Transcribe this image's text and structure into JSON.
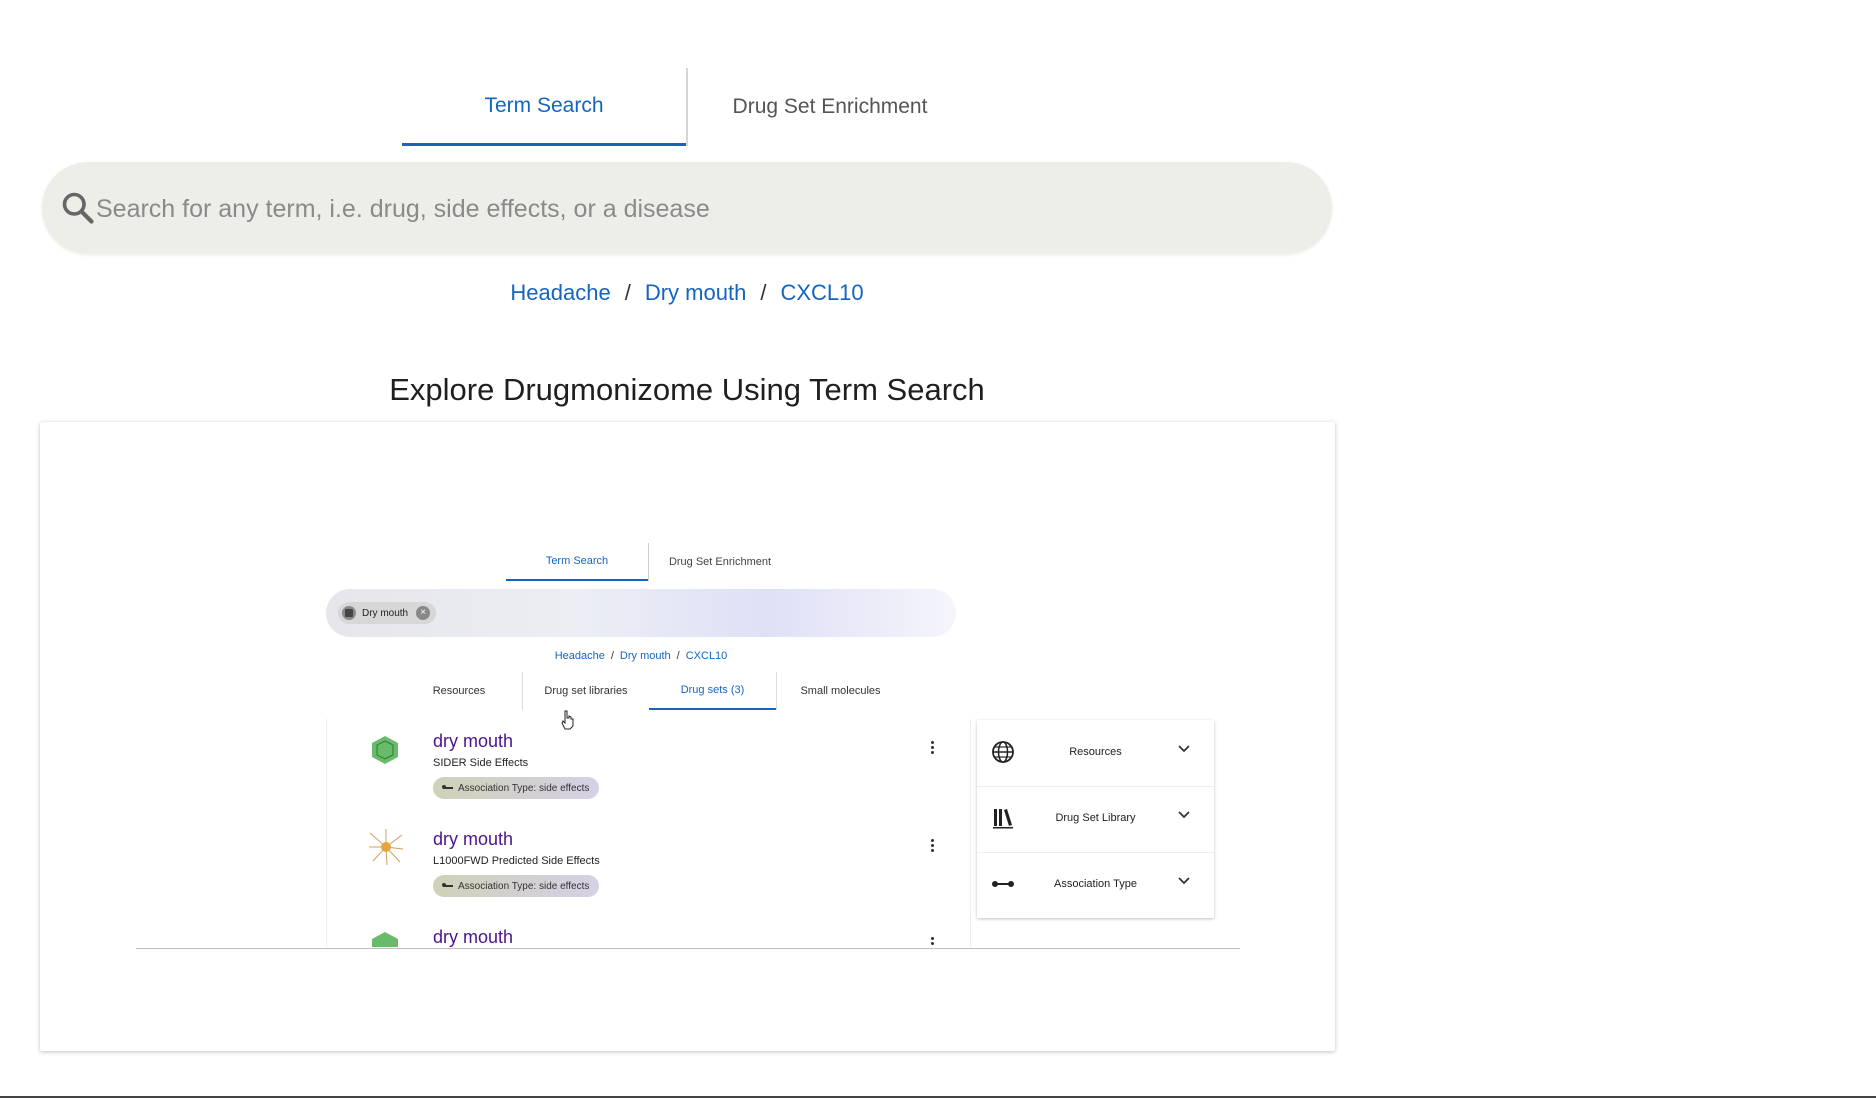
{
  "tabs": {
    "term_search": "Term Search",
    "drug_set_enrichment": "Drug Set Enrichment"
  },
  "search": {
    "placeholder": "Search for any term, i.e. drug, side effects, or a disease",
    "icon": "search-icon"
  },
  "breadcrumbs": [
    "Headache",
    "Dry mouth",
    "CXCL10"
  ],
  "heading": "Explore Drugmonizome Using Term Search",
  "demo": {
    "tabs": {
      "term_search": "Term Search",
      "drug_set_enrichment": "Drug Set Enrichment"
    },
    "chip": "Dry mouth",
    "breadcrumbs": [
      "Headache",
      "Dry mouth",
      "CXCL10"
    ],
    "subtabs": [
      "Resources",
      "Drug set libraries",
      "Drug sets (3)",
      "Small molecules"
    ],
    "active_subtab": "Drug sets (3)",
    "results": [
      {
        "title": "dry mouth",
        "library": "SIDER Side Effects",
        "badge": "Association Type: side effects",
        "icon": "hexagon-grid-icon"
      },
      {
        "title": "dry mouth",
        "library": "L1000FWD Predicted Side Effects",
        "badge": "Association Type: side effects",
        "icon": "starburst-icon"
      },
      {
        "title": "dry mouth",
        "library": "",
        "badge": "",
        "icon": "hexagon-grid-icon"
      }
    ],
    "filters": [
      {
        "label": "Resources",
        "icon": "globe-icon"
      },
      {
        "label": "Drug Set Library",
        "icon": "library-icon"
      },
      {
        "label": "Association Type",
        "icon": "association-icon"
      }
    ]
  },
  "colors": {
    "accent": "#1565c0",
    "result_title": "#4a148c",
    "search_bg": "#eeeee9"
  }
}
